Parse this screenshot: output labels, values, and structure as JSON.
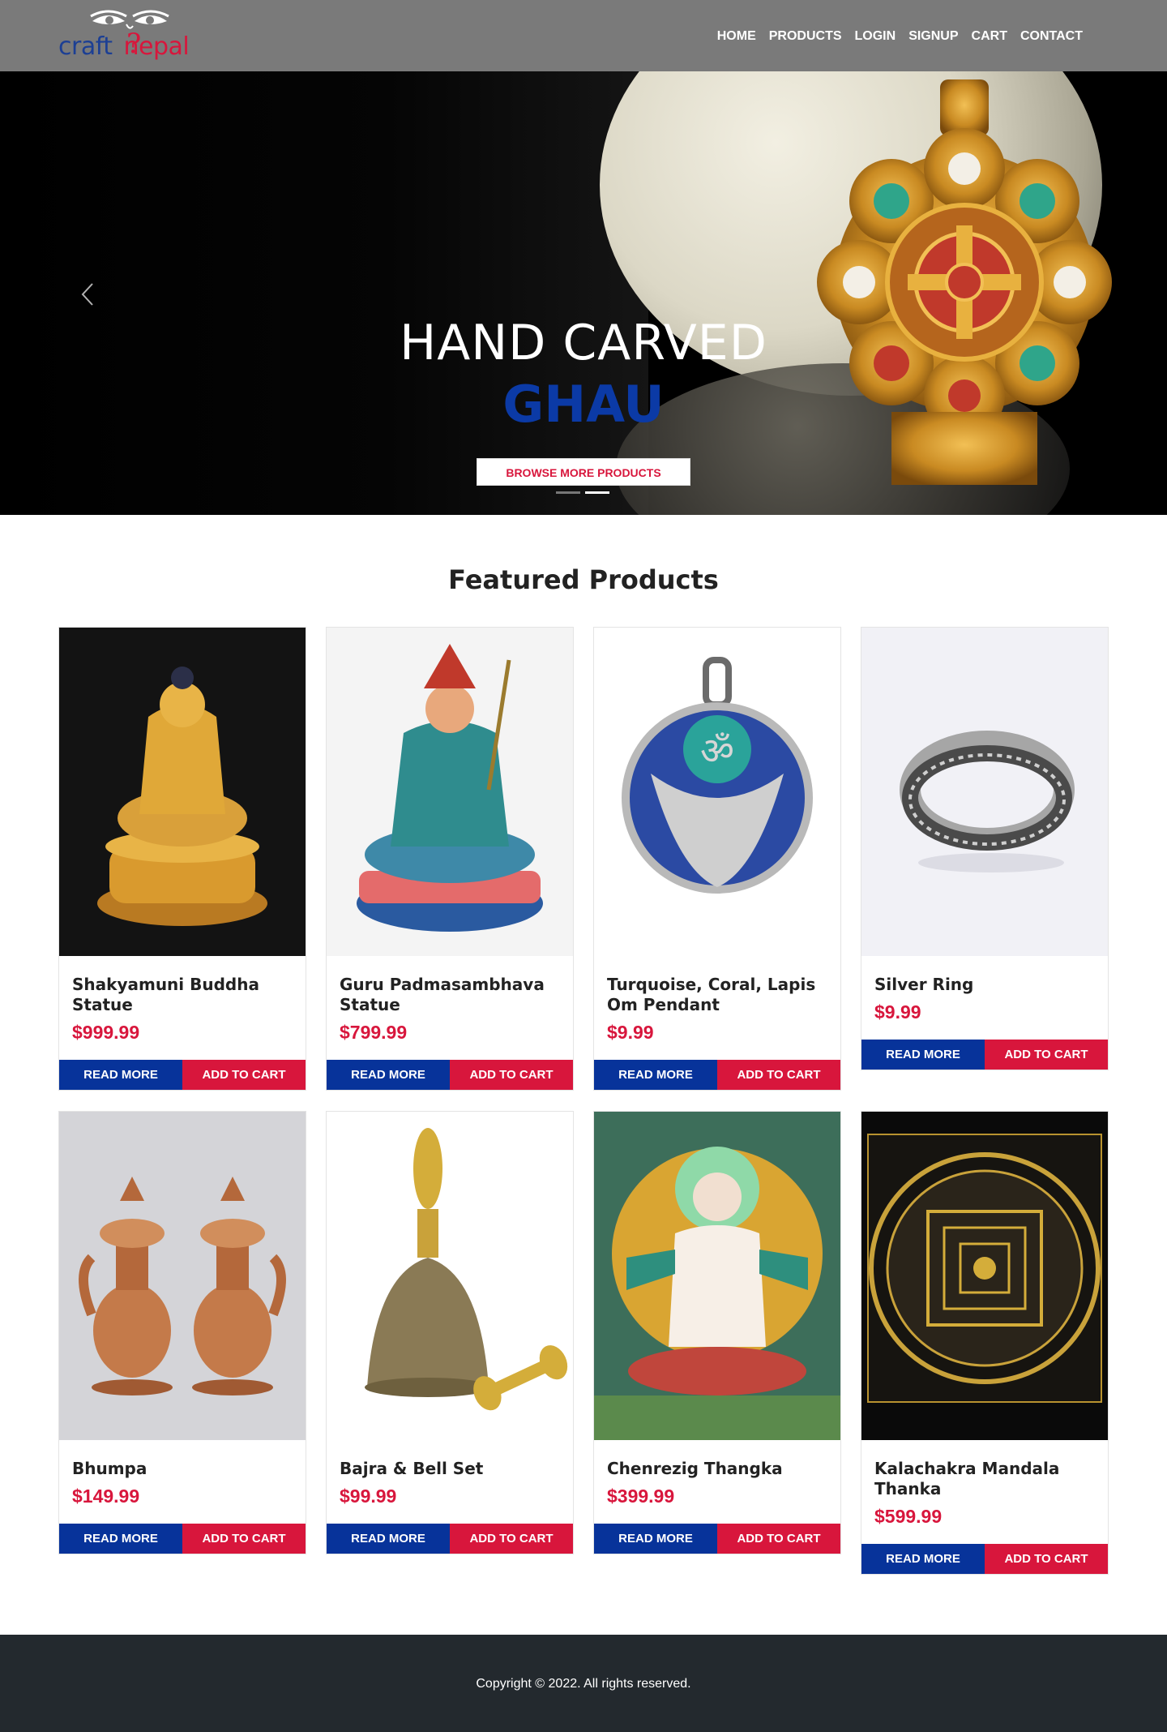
{
  "nav": {
    "logo_left": "craft",
    "logo_right": "nepal",
    "links": [
      "HOME",
      "PRODUCTS",
      "LOGIN",
      "SIGNUP",
      "CART",
      "CONTACT"
    ]
  },
  "hero": {
    "title": "HAND CARVED",
    "subtitle": "GHAU",
    "button": "BROWSE MORE PRODUCTS",
    "slide_count": 2,
    "active_slide": 2
  },
  "featured": {
    "title": "Featured Products",
    "read_more": "READ MORE",
    "add_to_cart": "ADD TO CART",
    "products": [
      {
        "name": "Shakyamuni Buddha Statue",
        "price": "$999.99"
      },
      {
        "name": "Guru Padmasambhava Statue",
        "price": "$799.99"
      },
      {
        "name": "Turquoise, Coral, Lapis Om Pendant",
        "price": "$9.99"
      },
      {
        "name": "Silver Ring",
        "price": "$9.99"
      },
      {
        "name": "Bhumpa",
        "price": "$149.99"
      },
      {
        "name": "Bajra & Bell Set",
        "price": "$99.99"
      },
      {
        "name": "Chenrezig Thangka",
        "price": "$399.99"
      },
      {
        "name": "Kalachakra Mandala Thanka",
        "price": "$599.99"
      }
    ]
  },
  "footer": {
    "copyright": "Copyright © 2022. All rights reserved."
  },
  "colors": {
    "nav_bg": "#7a7a7a",
    "brand_blue": "#07339a",
    "brand_red": "#d8163c",
    "footer_bg": "#23292e"
  }
}
